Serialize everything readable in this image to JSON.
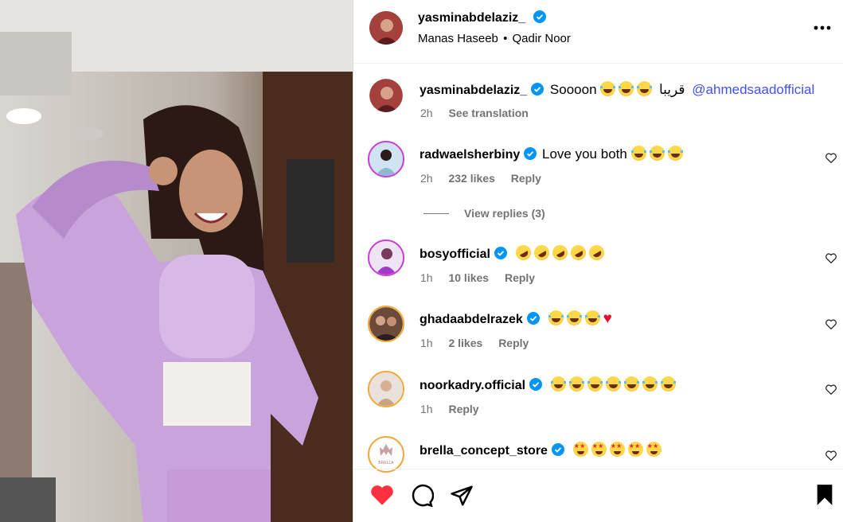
{
  "post": {
    "author": "yasminabdelaziz_",
    "collaborators": [
      "Manas Haseeb",
      "Qadir Noor"
    ],
    "separator": "•",
    "more_icon": "more-horizontal-icon"
  },
  "caption": {
    "username": "yasminabdelaziz_",
    "text": "Soooon",
    "arabic": "قريبا",
    "mention": "@ahmedsaadofficial",
    "emojis": [
      "laugh",
      "laugh",
      "laugh"
    ],
    "time": "2h",
    "see_translation": "See translation"
  },
  "comments": [
    {
      "username": "radwaelsherbiny",
      "text": "Love you both",
      "emojis": [
        "laugh",
        "laugh",
        "laugh"
      ],
      "time": "2h",
      "likes": "232 likes",
      "reply": "Reply",
      "view_replies": "View replies (3)"
    },
    {
      "username": "bosyofficial",
      "text": "",
      "emojis": [
        "rofl",
        "rofl",
        "rofl",
        "rofl",
        "rofl"
      ],
      "time": "1h",
      "likes": "10 likes",
      "reply": "Reply"
    },
    {
      "username": "ghadaabdelrazek",
      "text": "",
      "emojis": [
        "laugh",
        "laugh",
        "laugh",
        "heart"
      ],
      "time": "1h",
      "likes": "2 likes",
      "reply": "Reply"
    },
    {
      "username": "noorkadry.official",
      "text": "",
      "emojis": [
        "laugh",
        "laugh",
        "laugh",
        "laugh",
        "laugh",
        "laugh",
        "laugh"
      ],
      "time": "1h",
      "likes": "",
      "reply": "Reply"
    },
    {
      "username": "brella_concept_store",
      "text": "",
      "emojis": [
        "star-eyes",
        "star-eyes",
        "star-eyes",
        "star-eyes",
        "star-eyes"
      ],
      "time": "",
      "likes": "",
      "reply": "",
      "avatar_text": "BRELLA"
    }
  ],
  "colors": {
    "like_red": "#ff3040",
    "verified_blue": "#0095f6",
    "mention": "#4150f7",
    "muted": "#737373"
  }
}
